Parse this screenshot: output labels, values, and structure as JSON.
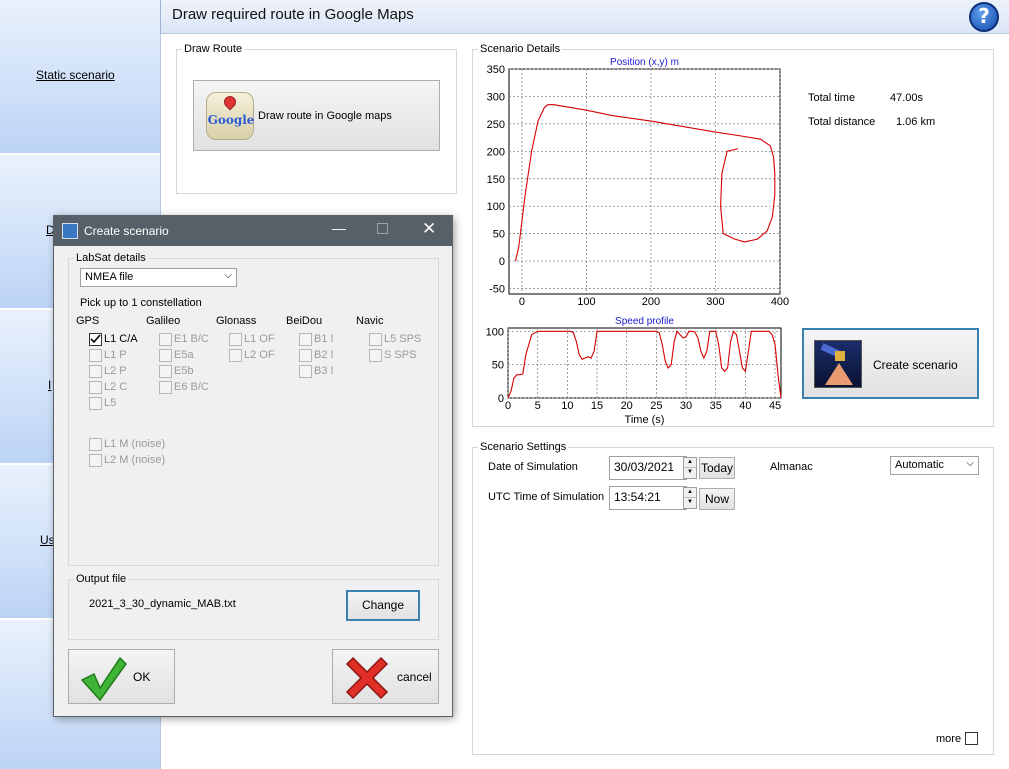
{
  "sidebar": {
    "items": [
      {
        "label": "Static scenario"
      },
      {
        "label": "D"
      },
      {
        "label": "I"
      },
      {
        "label": "Us"
      }
    ]
  },
  "header": {
    "title": "Draw required route in Google Maps",
    "help_icon": "help-question-icon"
  },
  "draw_route": {
    "group_label": "Draw Route",
    "button_label": "Draw route in Google maps",
    "icon": "google-maps-icon",
    "icon_text": "Google"
  },
  "scenario_details": {
    "group_label": "Scenario Details",
    "total_time_label": "Total time",
    "total_time_value": "47.00s",
    "total_distance_label": "Total distance",
    "total_distance_value": "1.06 km",
    "create_button_label": "Create scenario",
    "create_icon": "satellite-icon"
  },
  "scenario_settings": {
    "group_label": "Scenario Settings",
    "date_label": "Date of Simulation",
    "date_value": "30/03/2021",
    "today_label": "Today",
    "utc_label": "UTC Time of Simulation",
    "utc_value": "13:54:21",
    "now_label": "Now",
    "almanac_label": "Almanac",
    "almanac_value": "Automatic",
    "more_label": "more"
  },
  "dialog": {
    "title": "Create scenario",
    "app_icon": "labsat-app-icon",
    "labsat_group_label": "LabSat details",
    "file_type_value": "NMEA file",
    "pick_label": "Pick up to 1 constellation",
    "columns": [
      {
        "name": "GPS",
        "options": [
          {
            "label": "L1 C/A",
            "checked": true,
            "enabled": true
          },
          {
            "label": "L1 P",
            "checked": false,
            "enabled": false
          },
          {
            "label": "L2 P",
            "checked": false,
            "enabled": false
          },
          {
            "label": "L2 C",
            "checked": false,
            "enabled": false
          },
          {
            "label": "L5",
            "checked": false,
            "enabled": false
          }
        ]
      },
      {
        "name": "Galileo",
        "options": [
          {
            "label": "E1 B/C",
            "checked": false,
            "enabled": false
          },
          {
            "label": "E5a",
            "checked": false,
            "enabled": false
          },
          {
            "label": "E5b",
            "checked": false,
            "enabled": false
          },
          {
            "label": "E6 B/C",
            "checked": false,
            "enabled": false
          }
        ]
      },
      {
        "name": "Glonass",
        "options": [
          {
            "label": "L1 OF",
            "checked": false,
            "enabled": false
          },
          {
            "label": "L2 OF",
            "checked": false,
            "enabled": false
          }
        ]
      },
      {
        "name": "BeiDou",
        "options": [
          {
            "label": "B1 I",
            "checked": false,
            "enabled": false
          },
          {
            "label": "B2 I",
            "checked": false,
            "enabled": false
          },
          {
            "label": "B3 I",
            "checked": false,
            "enabled": false
          }
        ]
      },
      {
        "name": "Navic",
        "options": [
          {
            "label": "L5 SPS",
            "checked": false,
            "enabled": false
          },
          {
            "label": "S SPS",
            "checked": false,
            "enabled": false
          }
        ]
      }
    ],
    "noise_options": [
      {
        "label": "L1 M (noise)",
        "checked": false
      },
      {
        "label": "L2 M (noise)",
        "checked": false
      }
    ],
    "output_group_label": "Output file",
    "output_file_name": "2021_3_30_dynamic_MAB.txt",
    "change_label": "Change",
    "ok_label": "OK",
    "cancel_label": "cancel",
    "ok_icon": "green-check-icon",
    "cancel_icon": "red-x-icon"
  },
  "chart_data": [
    {
      "type": "line",
      "title": "Position (x,y) m",
      "xlim": [
        -20,
        400
      ],
      "ylim": [
        -60,
        350
      ],
      "xticks": [
        0,
        100,
        200,
        300,
        400
      ],
      "yticks": [
        -50,
        0,
        50,
        100,
        150,
        200,
        250,
        300,
        350
      ],
      "grid": true,
      "color": "#d80000",
      "x": [
        -10,
        -5,
        5,
        15,
        25,
        35,
        40,
        50,
        60,
        75,
        100,
        140,
        200,
        250,
        300,
        340,
        370,
        385,
        390,
        392,
        392,
        388,
        380,
        365,
        345,
        330,
        312,
        308,
        310,
        318,
        335
      ],
      "y": [
        0,
        25,
        120,
        200,
        255,
        280,
        285,
        285,
        283,
        280,
        275,
        265,
        255,
        245,
        235,
        228,
        222,
        210,
        190,
        160,
        120,
        80,
        55,
        40,
        35,
        40,
        50,
        100,
        160,
        200,
        205
      ]
    },
    {
      "type": "line",
      "title": "Speed profile",
      "xlabel": "Time (s)",
      "xlim": [
        0,
        46
      ],
      "ylim": [
        0,
        105
      ],
      "xticks": [
        0,
        5,
        10,
        15,
        20,
        25,
        30,
        35,
        40,
        45
      ],
      "yticks": [
        0,
        50,
        100
      ],
      "grid": true,
      "color": "#d80000",
      "x": [
        0,
        0.5,
        1,
        1.5,
        2,
        2.5,
        3,
        4,
        5,
        6,
        8,
        10,
        10.5,
        11,
        11.5,
        12,
        12.5,
        13,
        13.5,
        14,
        14.5,
        15,
        17,
        20,
        23,
        25,
        25.5,
        26,
        26.5,
        27,
        27.5,
        28,
        28.5,
        29,
        29.5,
        30,
        30.5,
        31,
        31.5,
        32,
        32.5,
        33,
        33.5,
        34,
        34.5,
        35,
        35.5,
        36,
        36.5,
        37,
        37.5,
        38,
        38.5,
        39,
        39.5,
        40,
        40.5,
        41,
        42,
        43,
        44,
        44.5,
        45,
        45.5,
        46
      ],
      "y": [
        0,
        10,
        30,
        35,
        35,
        36,
        65,
        95,
        100,
        100,
        100,
        100,
        100,
        98,
        85,
        65,
        58,
        60,
        62,
        60,
        70,
        100,
        100,
        100,
        100,
        100,
        98,
        80,
        55,
        45,
        50,
        85,
        100,
        95,
        90,
        92,
        100,
        100,
        99,
        90,
        70,
        60,
        70,
        100,
        100,
        100,
        80,
        45,
        40,
        45,
        85,
        100,
        95,
        70,
        45,
        40,
        70,
        100,
        100,
        100,
        100,
        95,
        80,
        35,
        0
      ]
    }
  ]
}
